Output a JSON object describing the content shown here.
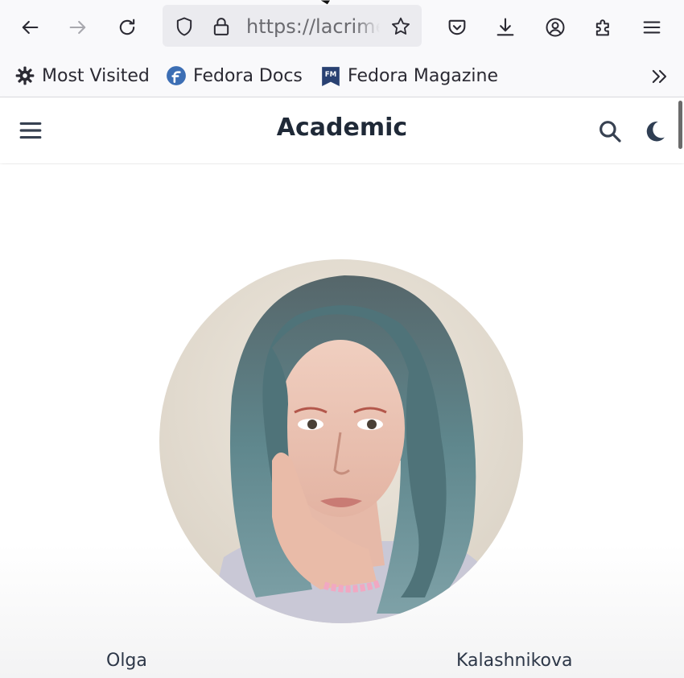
{
  "browser": {
    "url": "https://lacrimeb",
    "bookmarks": [
      {
        "label": "Most Visited",
        "icon": "gear-icon"
      },
      {
        "label": "Fedora Docs",
        "icon": "fedora-icon"
      },
      {
        "label": "Fedora Magazine",
        "icon": "fedora-magazine-icon",
        "badge": "FM"
      }
    ]
  },
  "site": {
    "title": "Academic"
  },
  "profile": {
    "first_name": "Olga",
    "last_name": "Kalashnikova"
  },
  "colors": {
    "toolbar_bg": "#f9f9fb",
    "urlbar_bg": "#ebebef",
    "title_text": "#1f2937",
    "nav_icon": "#374151",
    "moon_icon": "#2f3e53",
    "fedora_blue": "#3c6eb4",
    "fm_blue": "#294172"
  }
}
